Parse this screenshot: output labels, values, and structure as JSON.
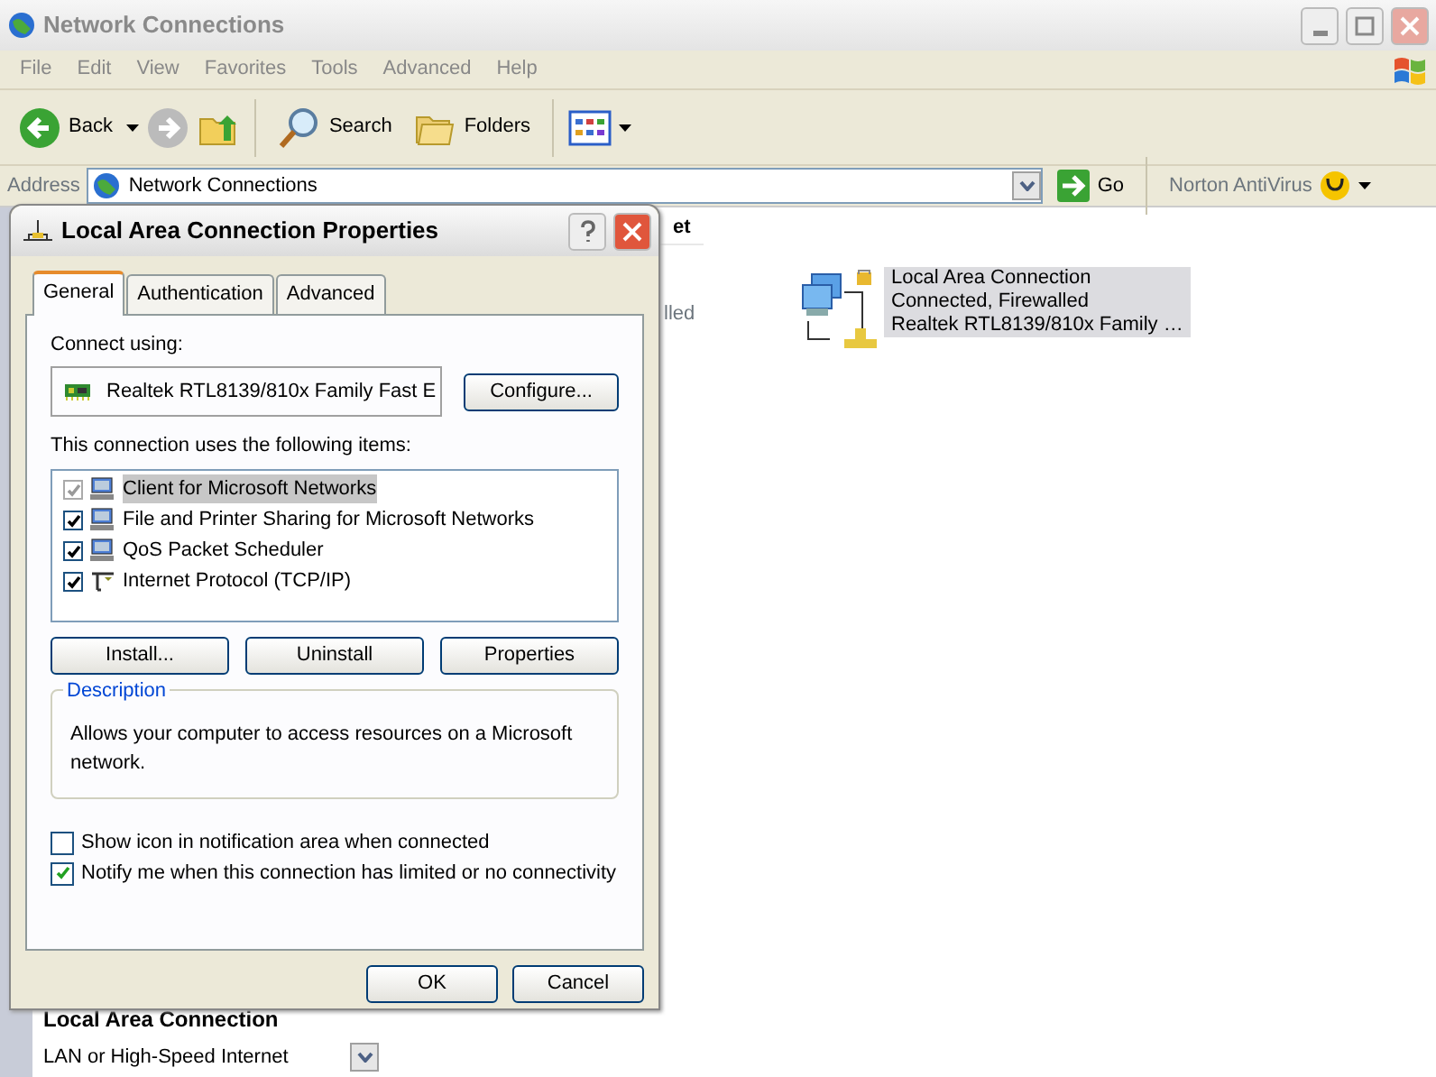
{
  "window": {
    "title": "Network Connections"
  },
  "menu": [
    "File",
    "Edit",
    "View",
    "Favorites",
    "Tools",
    "Advanced",
    "Help"
  ],
  "toolbar": {
    "back": "Back",
    "search": "Search",
    "folders": "Folders"
  },
  "address": {
    "label": "Address",
    "value": "Network Connections",
    "go": "Go",
    "norton": "Norton AntiVirus"
  },
  "content": {
    "header_fragment": "et",
    "covered_item_fragment": "lled",
    "item": {
      "lines": [
        "Local Area Connection",
        "Connected, Firewalled",
        "Realtek RTL8139/810x Family …"
      ],
      "selected": true
    }
  },
  "task_pane": {
    "title": "Local Area Connection",
    "subtitle": "LAN or High-Speed Internet"
  },
  "dialog": {
    "title": "Local Area Connection Properties",
    "tabs": [
      {
        "label": "General",
        "selected": true
      },
      {
        "label": "Authentication",
        "selected": false
      },
      {
        "label": "Advanced",
        "selected": false
      }
    ],
    "connect_using_label": "Connect using:",
    "adapter": "Realtek RTL8139/810x Family Fast E",
    "configure": "Configure...",
    "items_label": "This connection uses the following items:",
    "components": [
      {
        "label": "Client for Microsoft Networks",
        "kind": "computer",
        "checked": true,
        "disabled": true,
        "selected": true
      },
      {
        "label": "File and Printer Sharing for Microsoft Networks",
        "kind": "computer",
        "checked": true,
        "disabled": false,
        "selected": false
      },
      {
        "label": "QoS Packet Scheduler",
        "kind": "computer",
        "checked": true,
        "disabled": false,
        "selected": false
      },
      {
        "label": "Internet Protocol (TCP/IP)",
        "kind": "protocol",
        "checked": true,
        "disabled": false,
        "selected": false
      }
    ],
    "component_buttons": [
      "Install...",
      "Uninstall",
      "Properties"
    ],
    "description": {
      "label": "Description",
      "text": "Allows your computer to access resources on a Microsoft network."
    },
    "options": [
      {
        "label": "Show icon in notification area when connected",
        "checked": false
      },
      {
        "label": "Notify me when this connection has limited or no connectivity",
        "checked": true
      }
    ],
    "buttons": [
      "OK",
      "Cancel"
    ]
  }
}
